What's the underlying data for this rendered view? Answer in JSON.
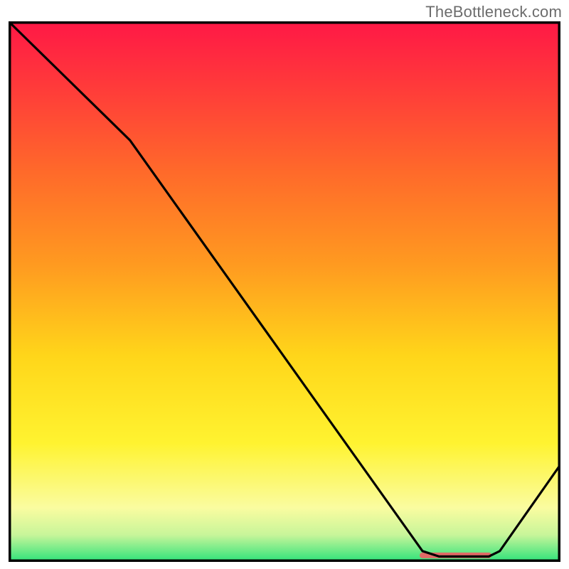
{
  "watermark": {
    "text": "TheBottleneck.com"
  },
  "chart_data": {
    "type": "line",
    "title": "",
    "xlabel": "",
    "ylabel": "",
    "xlim": [
      0,
      100
    ],
    "ylim": [
      0,
      100
    ],
    "grid": false,
    "legend": false,
    "note": "Axes are unlabeled; values estimated from pixel positions on a 0–100 normalized scale.",
    "background_gradient_stops": [
      {
        "pos": 0.0,
        "color": "#ff1846"
      },
      {
        "pos": 0.12,
        "color": "#ff3a3a"
      },
      {
        "pos": 0.28,
        "color": "#ff6a2a"
      },
      {
        "pos": 0.45,
        "color": "#ff9a20"
      },
      {
        "pos": 0.62,
        "color": "#ffd61a"
      },
      {
        "pos": 0.78,
        "color": "#fff330"
      },
      {
        "pos": 0.9,
        "color": "#fafca0"
      },
      {
        "pos": 0.95,
        "color": "#c8f59a"
      },
      {
        "pos": 1.0,
        "color": "#2ce27a"
      }
    ],
    "series": [
      {
        "name": "bottleneck-curve",
        "color": "#000000",
        "points": [
          {
            "x": 0,
            "y": 100
          },
          {
            "x": 22,
            "y": 78
          },
          {
            "x": 75,
            "y": 2
          },
          {
            "x": 78,
            "y": 1
          },
          {
            "x": 87,
            "y": 1
          },
          {
            "x": 89,
            "y": 2
          },
          {
            "x": 100,
            "y": 18
          }
        ]
      }
    ],
    "marker": {
      "name": "optimal-range-marker",
      "x_start": 75,
      "x_end": 87,
      "y": 1.2,
      "color": "#e06a66",
      "thickness": 8
    }
  }
}
